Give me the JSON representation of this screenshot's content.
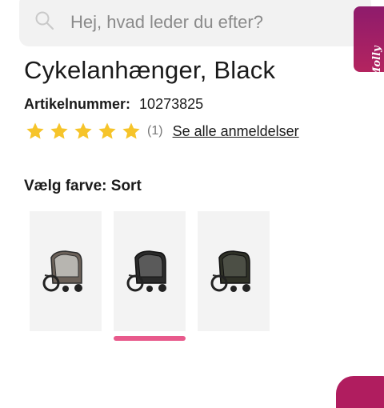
{
  "search": {
    "placeholder": "Hej, hvad leder du efter?"
  },
  "assistant_tab": {
    "label": "Molly"
  },
  "product": {
    "title": "Cykelanhænger, Black",
    "sku_label": "Artikelnummer:",
    "sku_value": "10273825"
  },
  "rating": {
    "stars": 5,
    "max_stars": 5,
    "count_label": "(1)",
    "reviews_link": "Se alle anmeldelser"
  },
  "color_selector": {
    "label": "Vælg farve:",
    "selected": "Sort",
    "options_count": 3,
    "selected_index": 1
  },
  "colors": {
    "star": "#f6c42a",
    "accent": "#e85a8c",
    "assistant_tab": "#9c1f67"
  },
  "icons": {
    "search": "search-icon",
    "star": "star-icon"
  }
}
